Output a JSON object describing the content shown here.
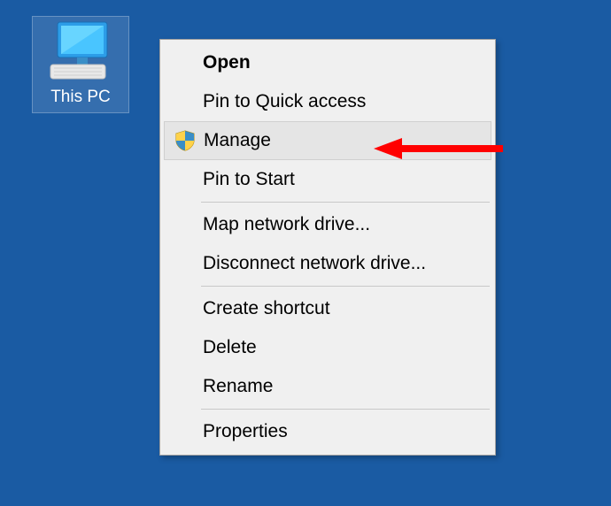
{
  "desktop": {
    "icon_label": "This PC"
  },
  "context_menu": {
    "open": "Open",
    "pin_quick": "Pin to Quick access",
    "manage": "Manage",
    "pin_start": "Pin to Start",
    "map_drive": "Map network drive...",
    "disconnect_drive": "Disconnect network drive...",
    "create_shortcut": "Create shortcut",
    "delete": "Delete",
    "rename": "Rename",
    "properties": "Properties"
  }
}
